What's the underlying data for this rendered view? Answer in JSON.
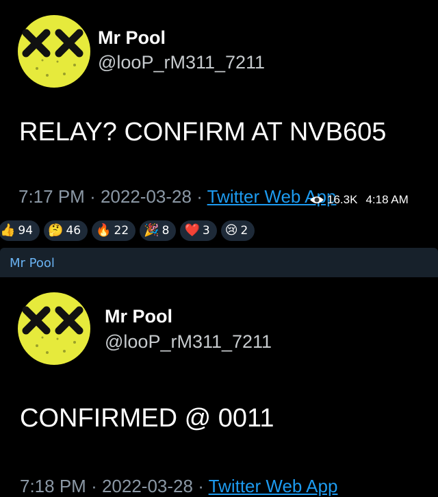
{
  "tweets": [
    {
      "display_name": "Mr Pool",
      "handle": "@looP_rM311_7211",
      "text": "RELAY? CONFIRM AT NVB605",
      "time": "7:17 PM",
      "date": "2022-03-28",
      "source": "Twitter Web App"
    },
    {
      "display_name": "Mr Pool",
      "handle": "@looP_rM311_7211",
      "text": "CONFIRMED @ 0011",
      "time": "7:18 PM",
      "date": "2022-03-28",
      "source": "Twitter Web App"
    }
  ],
  "message_overlay": {
    "views": "16.3K",
    "time": "4:18 AM",
    "icon": "eye-icon"
  },
  "reactions": [
    {
      "emoji": "👍",
      "count": "94",
      "icon": "thumbs-up-icon"
    },
    {
      "emoji": "🤔",
      "count": "46",
      "icon": "thinking-face-icon"
    },
    {
      "emoji": "🔥",
      "count": "22",
      "icon": "fire-icon"
    },
    {
      "emoji": "🎉",
      "count": "8",
      "icon": "party-popper-icon"
    },
    {
      "emoji": "❤️",
      "count": "3",
      "icon": "heart-icon"
    },
    {
      "emoji": "😢",
      "count": "2",
      "icon": "crying-face-icon"
    }
  ],
  "next_message": {
    "sender": "Mr Pool"
  },
  "colors": {
    "background": "#000000",
    "link": "#1d9bf0",
    "sender_name": "#6ab3f3",
    "reaction_pill": "#1e2a38",
    "avatar_yellow": "#e6ea3c"
  }
}
